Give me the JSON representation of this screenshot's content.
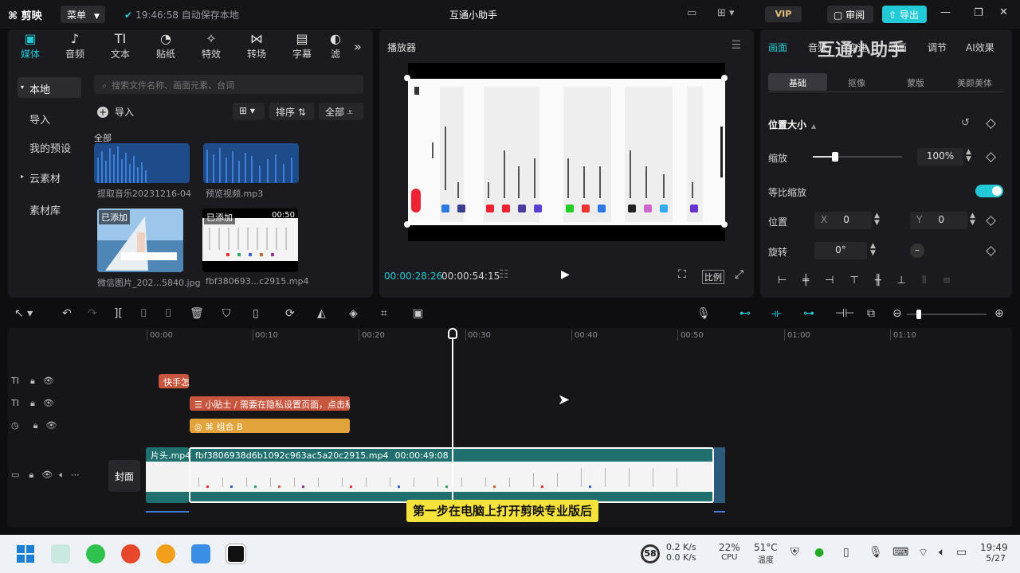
{
  "titlebar": {
    "logo": "剪映",
    "menu": "菜单",
    "autosave": "19:46:58 自动保存本地",
    "title": "互通小助手",
    "vip": "VIP",
    "review": "审阅",
    "export": "导出"
  },
  "watermark": "互通小助手",
  "media": {
    "tabs": [
      "媒体",
      "音频",
      "文本",
      "贴纸",
      "特效",
      "转场",
      "字幕",
      "滤"
    ],
    "tab_icons": [
      "▣",
      "♪",
      "TI",
      "◔",
      "✧",
      "⋈",
      "▤",
      "◐"
    ],
    "side": [
      "本地",
      "导入",
      "我的预设",
      "云素材",
      "素材库"
    ],
    "search_placeholder": "搜索文件名称、画面元素、台词",
    "import": "导入",
    "sort": "排序",
    "all_filter": "全部",
    "all_label": "全部",
    "items": [
      {
        "name": "提取音乐20231216-04",
        "tag": ""
      },
      {
        "name": "预览视频.mp3",
        "tag": ""
      },
      {
        "name": "微信图片_202...5840.jpg",
        "tag": "已添加"
      },
      {
        "name": "fbf380693...c2915.mp4",
        "tag": "已添加",
        "duration": "00:50"
      }
    ]
  },
  "player": {
    "title": "播放器",
    "current_time": "00:00:28:26",
    "total_time": "00:00:54:15",
    "ratio": "比例"
  },
  "props": {
    "tabs": [
      "画面",
      "音频",
      "变速",
      "动画",
      "调节",
      "AI效果"
    ],
    "subtabs": [
      "基础",
      "抠像",
      "蒙版",
      "美颜美体"
    ],
    "section": "位置大小",
    "scale_label": "缩放",
    "scale_value": "100%",
    "scale_level": 0.25,
    "uniform_label": "等比缩放",
    "position_label": "位置",
    "x_label": "X",
    "x_value": "0",
    "y_label": "Y",
    "y_value": "0",
    "rotate_label": "旋转",
    "rotate_value": "0°"
  },
  "timeline": {
    "ruler": [
      "00:00",
      "00:10",
      "00:20",
      "00:30",
      "00:40",
      "00:50",
      "01:00",
      "01:10"
    ],
    "clips": {
      "text1": "快手怎么",
      "text2": "小贴士 / 需要在隐私设置页面，点击私密",
      "group": "组合 B",
      "intro": "片头.mp4",
      "main": "fbf3806938d6b1092c963ac5a20c2915.mp4",
      "main_duration": "00:00:49:08"
    },
    "cover": "封面",
    "subtitle": "第一步在电脑上打开剪映专业版后"
  },
  "taskbar": {
    "badge": "58",
    "net_up": "0.2 K/s",
    "net_down": "0.0 K/s",
    "cpu_value": "22%",
    "cpu_label": "CPU",
    "temp_value": "51°C",
    "temp_label": "温度",
    "time": "19:49",
    "date": "5/27"
  },
  "colors": {
    "accent": "#22c9d6",
    "text_clip": "#c8553d",
    "group_clip": "#e2a43a",
    "video_clip": "#1f6f6f"
  }
}
